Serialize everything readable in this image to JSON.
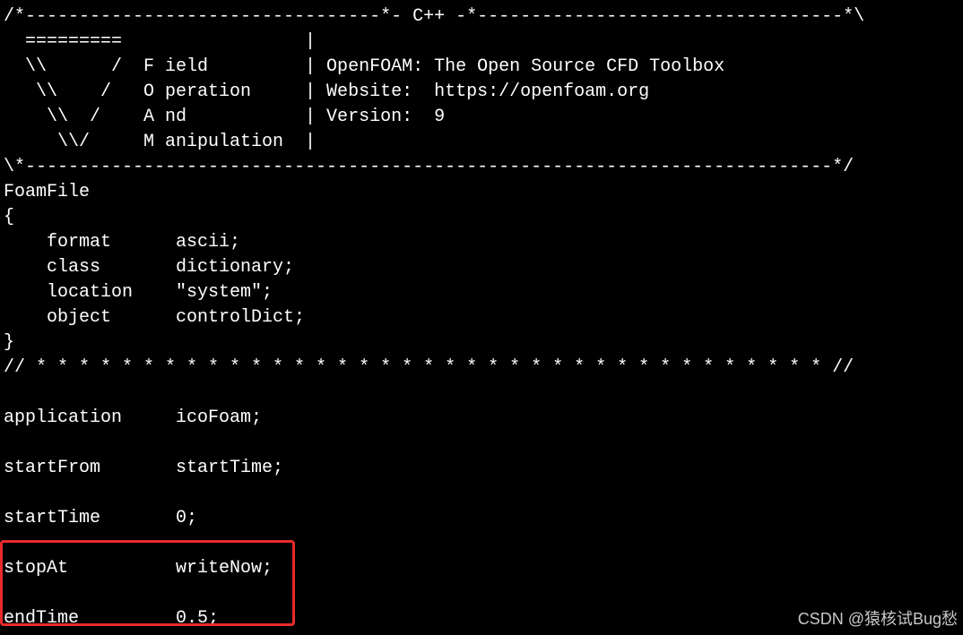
{
  "terminal": {
    "lines": [
      "/*---------------------------------*- C++ -*----------------------------------*\\",
      "  =========                 |",
      "  \\\\      /  F ield         | OpenFOAM: The Open Source CFD Toolbox",
      "   \\\\    /   O peration     | Website:  https://openfoam.org",
      "    \\\\  /    A nd           | Version:  9",
      "     \\\\/     M anipulation  |",
      "\\*---------------------------------------------------------------------------*/",
      "FoamFile",
      "{",
      "    format      ascii;",
      "    class       dictionary;",
      "    location    \"system\";",
      "    object      controlDict;",
      "}",
      "// * * * * * * * * * * * * * * * * * * * * * * * * * * * * * * * * * * * * * //",
      "",
      "application     icoFoam;",
      "",
      "startFrom       startTime;",
      "",
      "startTime       0;",
      "",
      "stopAt          writeNow;",
      "",
      "endTime         0.5;"
    ]
  },
  "highlight": {
    "color": "#e82b2b"
  },
  "watermark": {
    "text": "CSDN @猿核试Bug愁"
  }
}
